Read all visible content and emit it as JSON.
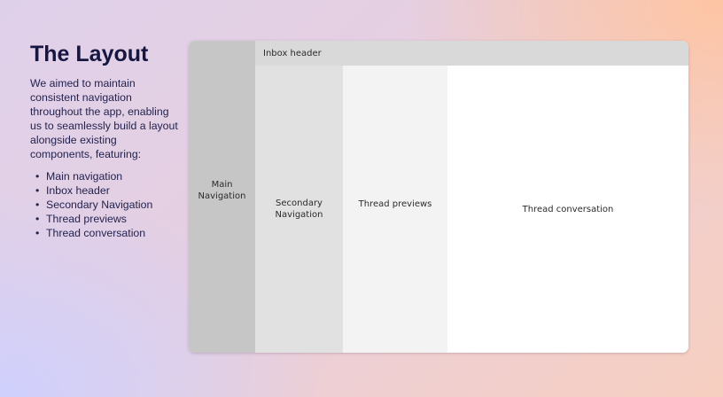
{
  "intro": {
    "title": "The Layout",
    "description": "We aimed to maintain consistent navigation throughout the app, enabling us to seamlessly build a layout alongside existing components, featuring:",
    "features": [
      "Main navigation",
      "Inbox header",
      "Secondary Navigation",
      "Thread previews",
      "Thread conversation"
    ]
  },
  "wireframe": {
    "main_navigation": "Main Navigation",
    "inbox_header": "Inbox header",
    "secondary_navigation": "Secondary Navigation",
    "thread_previews": "Thread previews",
    "thread_conversation": "Thread conversation"
  }
}
